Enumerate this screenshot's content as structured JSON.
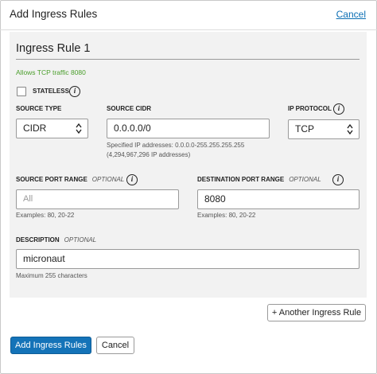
{
  "header": {
    "title": "Add Ingress Rules",
    "cancel_label": "Cancel"
  },
  "rule": {
    "title": "Ingress Rule 1",
    "description_text": "Allows TCP traffic 8080",
    "stateless": {
      "label": "STATELESS",
      "checked": false
    },
    "source_type": {
      "label": "SOURCE TYPE",
      "value": "CIDR"
    },
    "source_cidr": {
      "label": "SOURCE CIDR",
      "value": "0.0.0.0/0",
      "hint_line1": "Specified IP addresses: 0.0.0.0-255.255.255.255",
      "hint_line2": "(4,294,967,296 IP addresses)"
    },
    "ip_protocol": {
      "label": "IP PROTOCOL",
      "value": "TCP"
    },
    "source_port_range": {
      "label": "SOURCE PORT RANGE",
      "optional": "OPTIONAL",
      "placeholder": "All",
      "hint": "Examples: 80, 20-22"
    },
    "destination_port_range": {
      "label": "DESTINATION PORT RANGE",
      "optional": "OPTIONAL",
      "value": "8080",
      "hint": "Examples: 80, 20-22"
    },
    "description": {
      "label": "DESCRIPTION",
      "optional": "OPTIONAL",
      "value": "micronaut",
      "hint": "Maximum 255 characters"
    }
  },
  "buttons": {
    "another_rule": "+ Another Ingress Rule",
    "add_rules": "Add Ingress Rules",
    "cancel": "Cancel"
  },
  "icons": {
    "info": "info-icon",
    "select": "chevron-up-down-icon"
  },
  "colors": {
    "primary": "#1473b8",
    "link": "#0c6fb4",
    "success_text": "#4a9e2b",
    "panel_bg": "#f2f2f2"
  }
}
